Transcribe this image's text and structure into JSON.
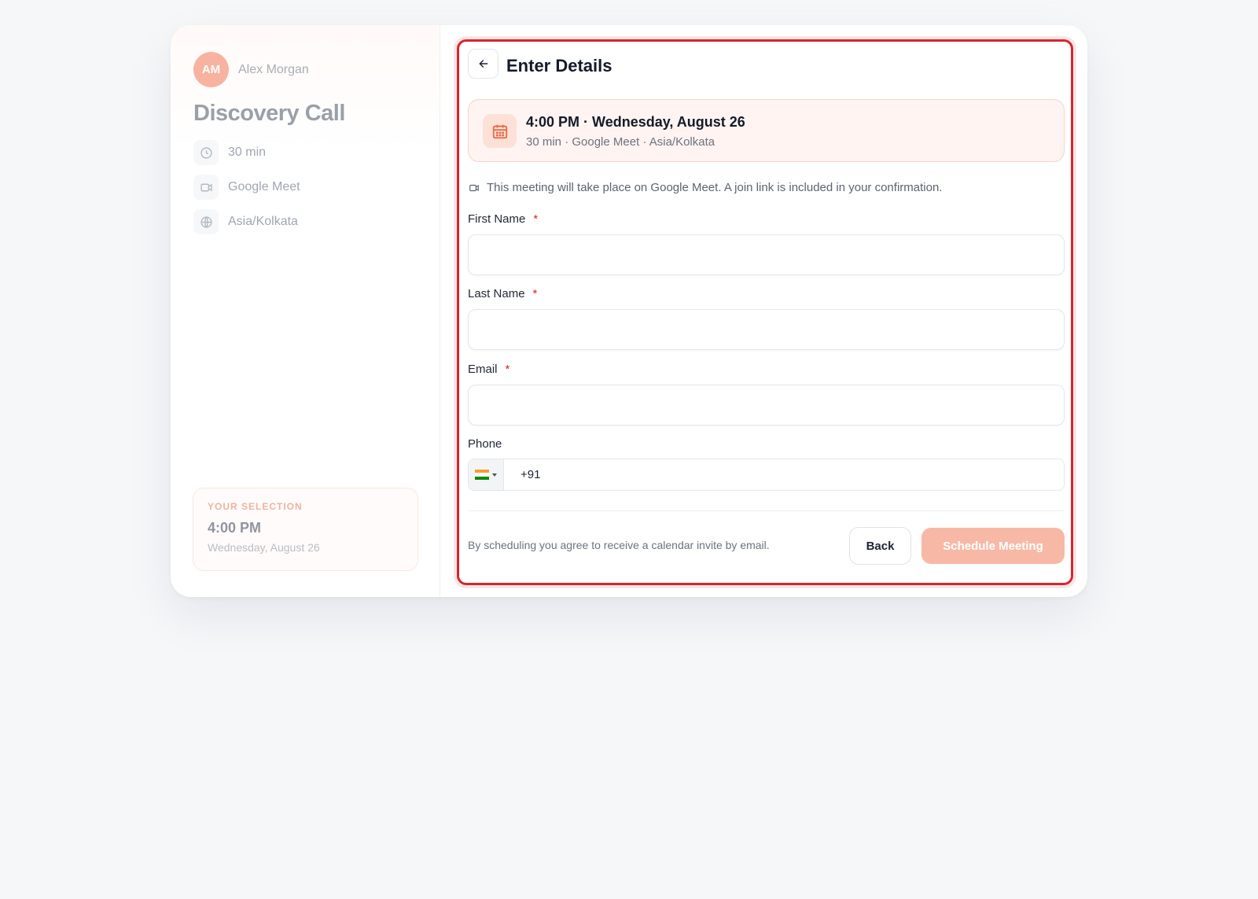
{
  "host": {
    "initials": "AM",
    "name": "Alex Morgan"
  },
  "event": {
    "title": "Discovery Call",
    "duration": "30 min",
    "location": "Google Meet",
    "timezone": "Asia/Kolkata"
  },
  "selection": {
    "label": "YOUR SELECTION",
    "time": "4:00 PM",
    "date": "Wednesday, August 26"
  },
  "details": {
    "heading": "Enter Details",
    "summary_title": "4:00 PM · Wednesday, August 26",
    "summary_sub": "30 min · Google Meet · Asia/Kolkata",
    "note": "This meeting will take place on Google Meet. A join link is included in your confirmation."
  },
  "form": {
    "first_name_label": "First Name",
    "last_name_label": "Last Name",
    "email_label": "Email",
    "phone_label": "Phone",
    "required_mark": "*",
    "first_name_value": "",
    "last_name_value": "",
    "email_value": "",
    "phone_code": "+91",
    "country_flag": "india-flag-icon"
  },
  "footer": {
    "legal": "By scheduling you agree to receive a calendar invite by email.",
    "back_label": "Back",
    "schedule_label": "Schedule Meeting"
  },
  "colors": {
    "accent": "#f7b9a6",
    "highlight_border": "#d7262e",
    "required": "#d7262e"
  }
}
